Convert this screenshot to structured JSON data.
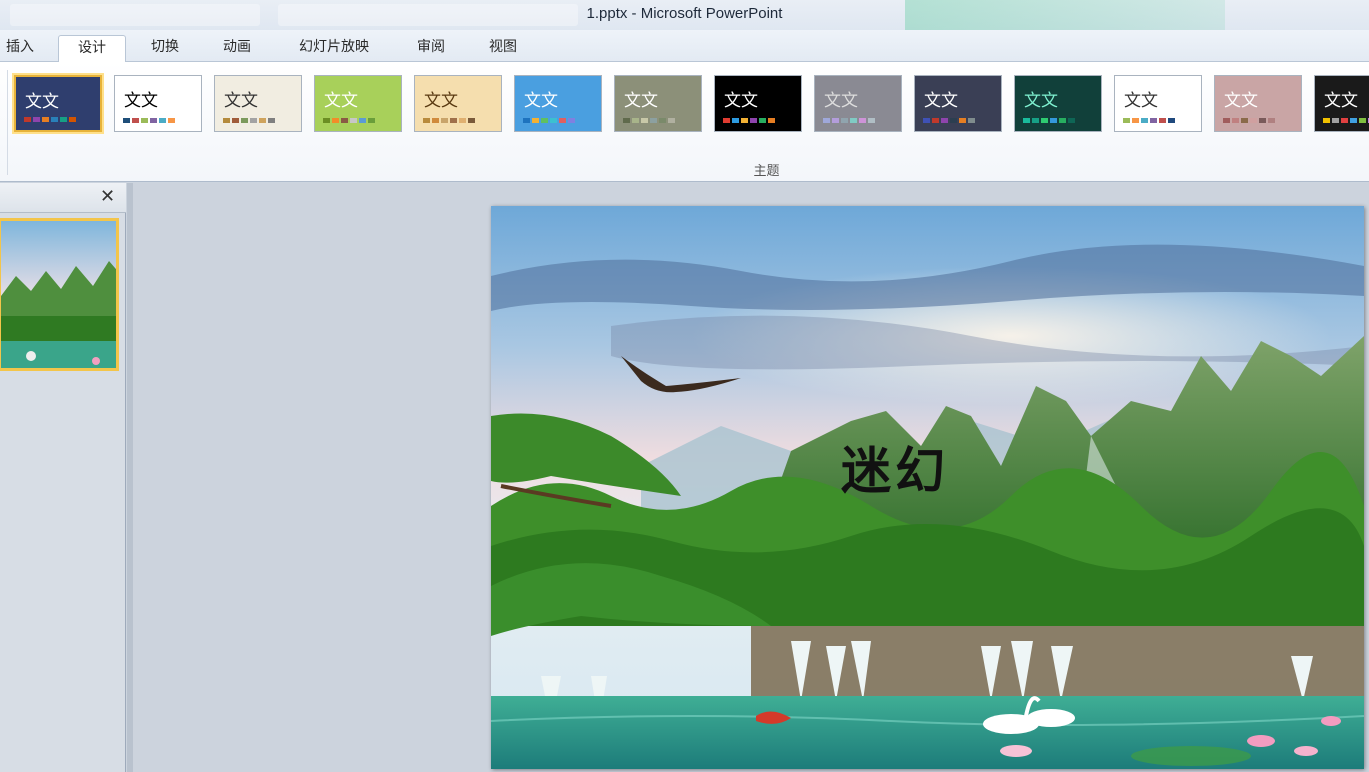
{
  "window": {
    "title": "1.pptx - Microsoft PowerPoint"
  },
  "tabs": [
    {
      "label": "插入",
      "active": false
    },
    {
      "label": "设计",
      "active": true
    },
    {
      "label": "切换",
      "active": false
    },
    {
      "label": "动画",
      "active": false
    },
    {
      "label": "幻灯片放映",
      "active": false
    },
    {
      "label": "审阅",
      "active": false
    },
    {
      "label": "视图",
      "active": false
    }
  ],
  "ribbon": {
    "group_label": "主题",
    "themes": [
      {
        "sample": "文文",
        "bg": "#2f3e6e",
        "fg": "#ffffff",
        "selected": true,
        "swatches": [
          "#c0392b",
          "#8e44ad",
          "#e67e22",
          "#2980b9",
          "#16a085",
          "#d35400"
        ]
      },
      {
        "sample": "文文",
        "bg": "#ffffff",
        "fg": "#000000",
        "selected": false,
        "swatches": [
          "#1f4e79",
          "#c0504d",
          "#9bbb59",
          "#8064a2",
          "#4bacc6",
          "#f79646"
        ]
      },
      {
        "sample": "文文",
        "bg": "#f1ede1",
        "fg": "#333333",
        "selected": false,
        "swatches": [
          "#b48a3c",
          "#a05c3a",
          "#7c9a5c",
          "#a3a3a3",
          "#cfa35c",
          "#7f7f7f"
        ]
      },
      {
        "sample": "文文",
        "bg": "#a8d05a",
        "fg": "#ffffff",
        "selected": false,
        "swatches": [
          "#6b8e23",
          "#f28c28",
          "#8a5a44",
          "#c7c7c7",
          "#5b9bd5",
          "#6a9e3a"
        ]
      },
      {
        "sample": "文文",
        "bg": "#f5deae",
        "fg": "#5a3a12",
        "selected": false,
        "swatches": [
          "#b88a3c",
          "#d08a3c",
          "#c9a46a",
          "#a0704a",
          "#e0b070",
          "#7a5a3a"
        ]
      },
      {
        "sample": "文文",
        "bg": "#4a9fe0",
        "fg": "#ffffff",
        "selected": false,
        "swatches": [
          "#1e73be",
          "#f2b134",
          "#60c060",
          "#3cc0d0",
          "#e06060",
          "#8080e0"
        ]
      },
      {
        "sample": "文文",
        "bg": "#8c9079",
        "fg": "#ffffff",
        "selected": false,
        "swatches": [
          "#606a4c",
          "#a8b48a",
          "#c8c8a8",
          "#8ca0a0",
          "#7a8a6a",
          "#b0b0a0"
        ]
      },
      {
        "sample": "文文",
        "bg": "#000000",
        "fg": "#ffffff",
        "selected": false,
        "swatches": [
          "#e03c31",
          "#2d9be0",
          "#f2b134",
          "#8e44ad",
          "#27ae60",
          "#e67e22"
        ]
      },
      {
        "sample": "文文",
        "bg": "#8a8a93",
        "fg": "#dddddd",
        "selected": false,
        "swatches": [
          "#9fa8da",
          "#b39ddb",
          "#90a4ae",
          "#80cbc4",
          "#ce93d8",
          "#b0bec5"
        ]
      },
      {
        "sample": "文文",
        "bg": "#3a3f55",
        "fg": "#ffffff",
        "selected": false,
        "swatches": [
          "#3f51b5",
          "#c0392b",
          "#8e44ad",
          "#2c3e50",
          "#e67e22",
          "#7f8c8d"
        ]
      },
      {
        "sample": "文文",
        "bg": "#11403a",
        "fg": "#7ff0d0",
        "selected": false,
        "swatches": [
          "#1abc9c",
          "#16a085",
          "#2ecc71",
          "#3498db",
          "#27ae60",
          "#0e6655"
        ]
      },
      {
        "sample": "文文",
        "bg": "#ffffff",
        "fg": "#333333",
        "selected": false,
        "swatches": [
          "#9bbb59",
          "#f79646",
          "#4bacc6",
          "#8064a2",
          "#c0504d",
          "#1f497d"
        ]
      },
      {
        "sample": "文文",
        "bg": "#c9a5a5",
        "fg": "#ffffff",
        "selected": false,
        "swatches": [
          "#a05c5c",
          "#c08080",
          "#8a6a4a",
          "#d0a0a0",
          "#7a5a5a",
          "#b08080"
        ]
      },
      {
        "sample": "文文",
        "bg": "#1a1a1a",
        "fg": "#ffffff",
        "selected": false,
        "swatches": [
          "#f2c200",
          "#a0a0a0",
          "#e04040",
          "#40a0e0",
          "#80c040",
          "#c080e0"
        ]
      }
    ]
  },
  "slide": {
    "title": "迷幻"
  },
  "icons": {
    "close": "close-icon"
  }
}
